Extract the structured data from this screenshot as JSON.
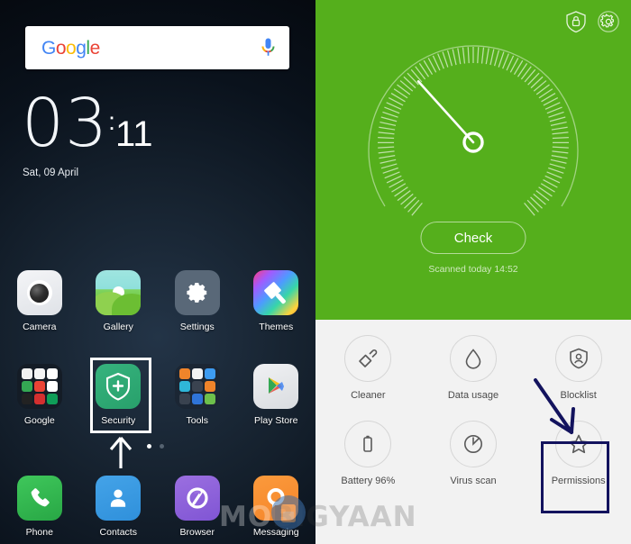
{
  "home": {
    "search": {
      "brand_parts": [
        "G",
        "o",
        "o",
        "g",
        "l",
        "e"
      ],
      "brand": "Google",
      "mic_icon": "microphone-icon"
    },
    "clock": {
      "hours": "03",
      "colon": ":",
      "minutes": "11"
    },
    "date": "Sat, 09 April",
    "rows": [
      [
        {
          "label": "Camera",
          "icon": "camera-icon"
        },
        {
          "label": "Gallery",
          "icon": "gallery-icon"
        },
        {
          "label": "Settings",
          "icon": "gear-icon"
        },
        {
          "label": "Themes",
          "icon": "paintbrush-icon"
        }
      ],
      [
        {
          "label": "Google",
          "icon": "google-folder-icon"
        },
        {
          "label": "Security",
          "icon": "shield-plus-icon"
        },
        {
          "label": "Tools",
          "icon": "tools-folder-icon"
        },
        {
          "label": "Play Store",
          "icon": "play-store-icon"
        }
      ]
    ],
    "dock": [
      {
        "label": "Phone",
        "icon": "phone-icon"
      },
      {
        "label": "Contacts",
        "icon": "person-icon"
      },
      {
        "label": "Browser",
        "icon": "browser-icon"
      },
      {
        "label": "Messaging",
        "icon": "message-icon"
      }
    ],
    "page_dots": {
      "count": 2,
      "active": 0
    },
    "highlight": {
      "target": "Security",
      "color": "#ffffff",
      "arrow_icon": "arrow-up-icon"
    }
  },
  "security_app": {
    "header_icons": [
      {
        "name": "shield-lock-icon"
      },
      {
        "name": "gear-icon"
      }
    ],
    "gauge": {
      "needle_angle_deg": 228,
      "tick_count": 90
    },
    "check_button": "Check",
    "scanned_status": "Scanned today 14:52",
    "accent_green": "#55af1c",
    "panel_bg": "#f2f2f2",
    "tools": [
      {
        "label": "Cleaner",
        "icon": "brush-icon"
      },
      {
        "label": "Data usage",
        "icon": "droplet-icon"
      },
      {
        "label": "Blocklist",
        "icon": "shield-person-icon"
      },
      {
        "label": "Battery 96%",
        "icon": "battery-icon"
      },
      {
        "label": "Virus scan",
        "icon": "scan-clock-icon"
      },
      {
        "label": "Permissions",
        "icon": "star-icon"
      }
    ],
    "highlight": {
      "target": "Permissions",
      "color": "#13135e",
      "arrow_icon": "arrow-down-right-icon"
    }
  },
  "watermark": {
    "text_a": "MO",
    "text_b": "BIGYAAN",
    "full": "MOBIGYAAN",
    "logo_icon": "mobigyaan-logo-icon"
  }
}
